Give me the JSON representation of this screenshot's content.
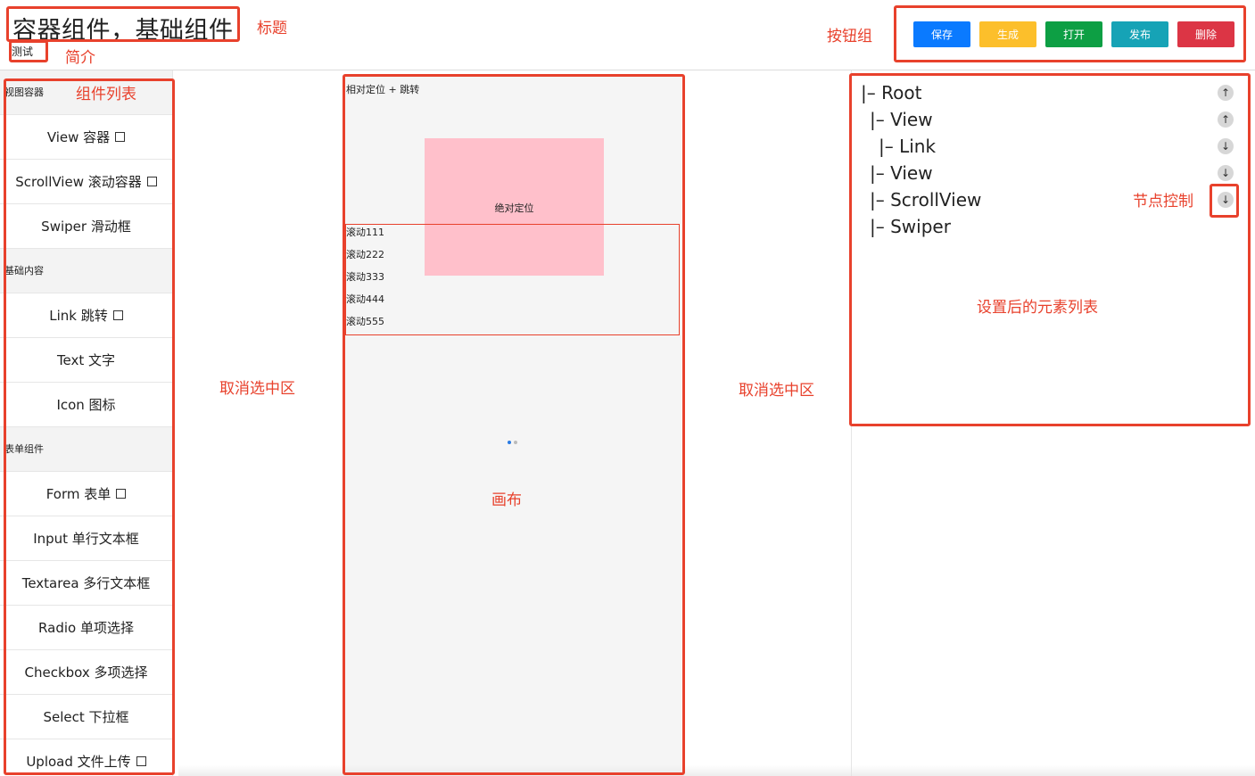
{
  "header": {
    "title": "容器组件，基础组件",
    "description": "测试"
  },
  "toolbar": {
    "buttons": [
      {
        "label": "保存",
        "color": "#0a7aff"
      },
      {
        "label": "生成",
        "color": "#fcbf2b"
      },
      {
        "label": "打开",
        "color": "#0d9f44"
      },
      {
        "label": "发布",
        "color": "#16a3b6"
      },
      {
        "label": "删除",
        "color": "#dc3545"
      }
    ]
  },
  "component_list": {
    "groups": [
      {
        "title": "视图容器",
        "items": [
          "View 容器",
          "ScrollView 滚动容器",
          "Swiper 滑动框"
        ],
        "checkbox": [
          true,
          true,
          false
        ]
      },
      {
        "title": "基础内容",
        "items": [
          "Link 跳转",
          "Text 文字",
          "Icon 图标"
        ],
        "checkbox": [
          true,
          false,
          false
        ]
      },
      {
        "title": "表单组件",
        "items": [
          "Form 表单",
          "Input 单行文本框",
          "Textarea 多行文本框",
          "Radio 单项选择",
          "Checkbox 多项选择",
          "Select 下拉框",
          "Upload 文件上传"
        ],
        "checkbox": [
          true,
          false,
          false,
          false,
          false,
          false,
          true
        ]
      }
    ]
  },
  "canvas": {
    "caption": "相对定位 + 跳转",
    "absolute_label": "绝对定位",
    "scroll_items": [
      "滚动111",
      "滚动222",
      "滚动333",
      "滚动444",
      "滚动555"
    ],
    "swiper_dot_colors": [
      "#2a7be4",
      "#bbbbbb"
    ]
  },
  "tree": {
    "nodes": [
      {
        "prefix": "|– ",
        "label": "Root",
        "control": "↑"
      },
      {
        "prefix": "|– ",
        "label": "View",
        "control": "↑"
      },
      {
        "prefix": "|– ",
        "label": "Link",
        "control": "↓"
      },
      {
        "prefix": "|– ",
        "label": "View",
        "control": "↓"
      },
      {
        "prefix": "|– ",
        "label": "ScrollView",
        "control": "↓"
      },
      {
        "prefix": "|– ",
        "label": "Swiper",
        "control": ""
      }
    ]
  },
  "annotations": {
    "title": "标题",
    "description": "简介",
    "button_group": "按钮组",
    "component_list": "组件列表",
    "deselect_left": "取消选中区",
    "deselect_right": "取消选中区",
    "canvas": "画布",
    "node_control": "节点控制",
    "element_list": "设置后的元素列表"
  },
  "colors": {
    "annotation_red": "#e8412c",
    "absolute_box": "#ffc0cb"
  }
}
